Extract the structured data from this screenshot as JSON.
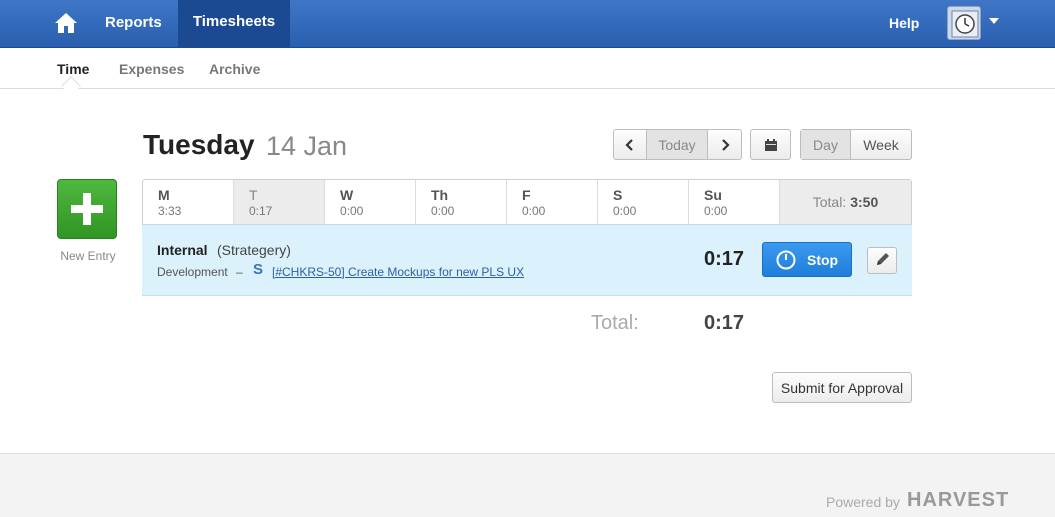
{
  "topnav": {
    "reports_label": "Reports",
    "timesheets_label": "Timesheets",
    "help_label": "Help",
    "home_icon": "home-icon",
    "avatar_icon": "clock-avatar-icon"
  },
  "subnav": {
    "tabs": [
      {
        "label": "Time",
        "active": true
      },
      {
        "label": "Expenses",
        "active": false
      },
      {
        "label": "Archive",
        "active": false
      }
    ]
  },
  "header": {
    "weekday": "Tuesday",
    "date": "14 Jan",
    "today_label": "Today",
    "view_day_label": "Day",
    "view_week_label": "Week"
  },
  "new_entry": {
    "label": "New Entry"
  },
  "week": {
    "days": [
      {
        "name": "M",
        "hours": "3:33",
        "selected": false
      },
      {
        "name": "T",
        "hours": "0:17",
        "selected": true
      },
      {
        "name": "W",
        "hours": "0:00",
        "selected": false
      },
      {
        "name": "Th",
        "hours": "0:00",
        "selected": false
      },
      {
        "name": "F",
        "hours": "0:00",
        "selected": false
      },
      {
        "name": "S",
        "hours": "0:00",
        "selected": false
      },
      {
        "name": "Su",
        "hours": "0:00",
        "selected": false
      }
    ],
    "total_label": "Total:",
    "total_value": "3:50"
  },
  "entry": {
    "project": "Internal",
    "client": "(Strategery)",
    "task": "Development",
    "separator": "–",
    "link_text": "[#CHKRS-50] Create Mockups for new PLS UX",
    "time": "0:17",
    "stop_label": "Stop"
  },
  "totals": {
    "label": "Total:",
    "value": "0:17"
  },
  "submit_label": "Submit for Approval",
  "footer": {
    "powered_by": "Powered by",
    "brand": "HARVEST"
  },
  "colors": {
    "topbar": "#2f66b8",
    "active_nav": "#1c4a92",
    "entry_bg": "#dbf1fb",
    "new_entry_green": "#3fa930",
    "stop_blue": "#2a8be4"
  }
}
